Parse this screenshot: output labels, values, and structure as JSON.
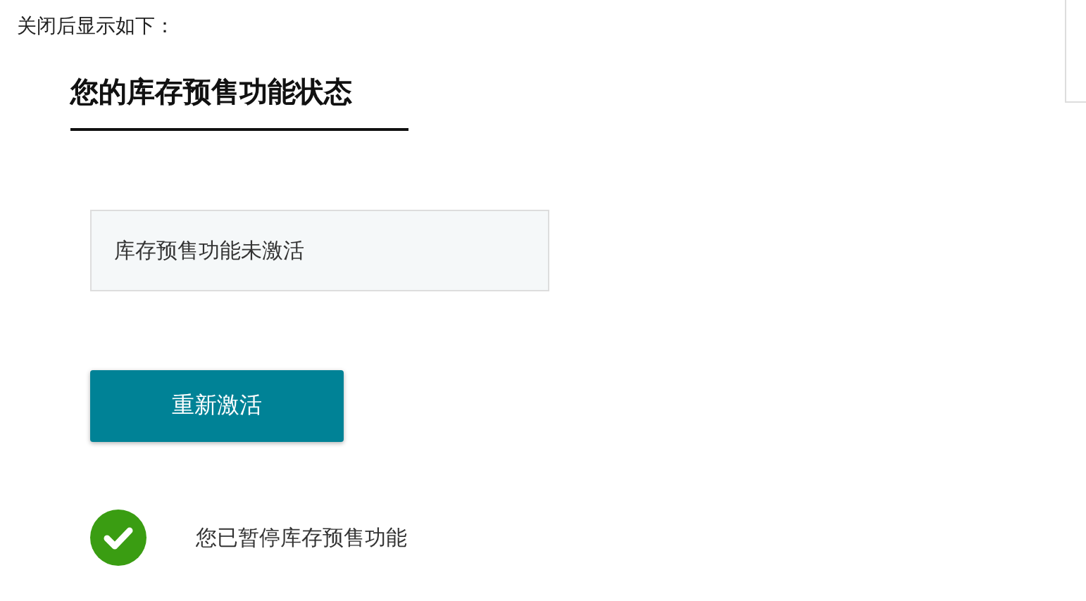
{
  "intro": "关闭后显示如下：",
  "heading": "您的库存预售功能状态",
  "status_box": {
    "text": "库存预售功能未激活"
  },
  "button": {
    "label": "重新激活"
  },
  "notice": {
    "kind": "success",
    "text": "您已暂停库存预售功能"
  }
}
